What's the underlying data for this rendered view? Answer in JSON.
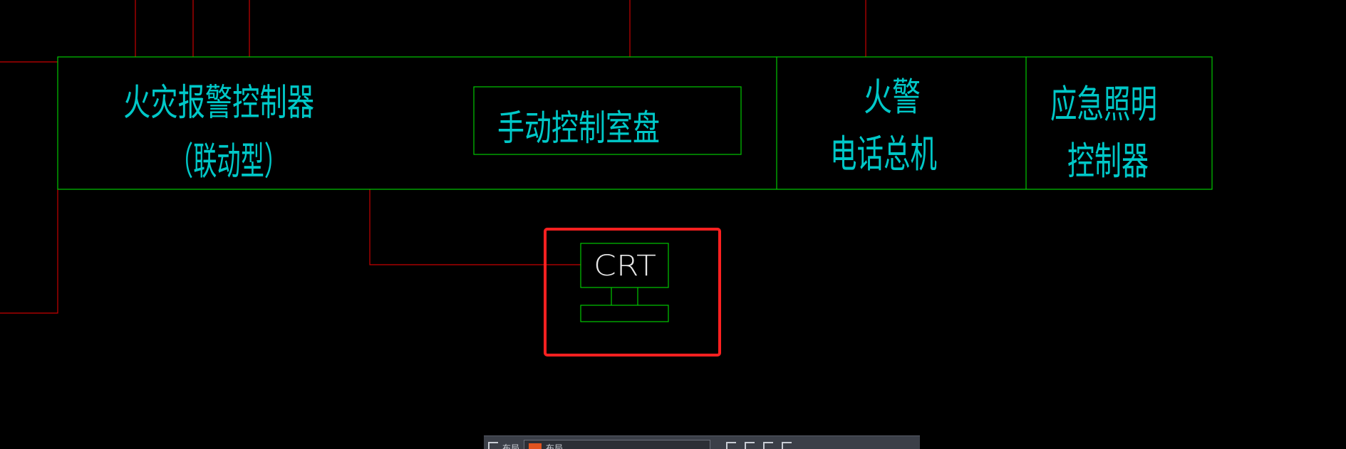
{
  "diagram": {
    "colors": {
      "background": "#000000",
      "box_outline": "#00c800",
      "text": "#00c8c8",
      "wire": "#c80000",
      "highlight": "#ff2020"
    },
    "labels": {
      "fire_alarm_controller": "火灾报警控制器",
      "linkage_type": "（联动型）",
      "manual_control_panel": "手动控制室盘",
      "fire_phone_line1": "火警",
      "fire_phone_line2": "电话总机",
      "emergency_lighting_line1": "应急照明",
      "emergency_lighting_line2": "控制器",
      "crt": "CRT"
    }
  },
  "toolbar": {
    "left_label": "布局",
    "tab_label": "布局"
  }
}
